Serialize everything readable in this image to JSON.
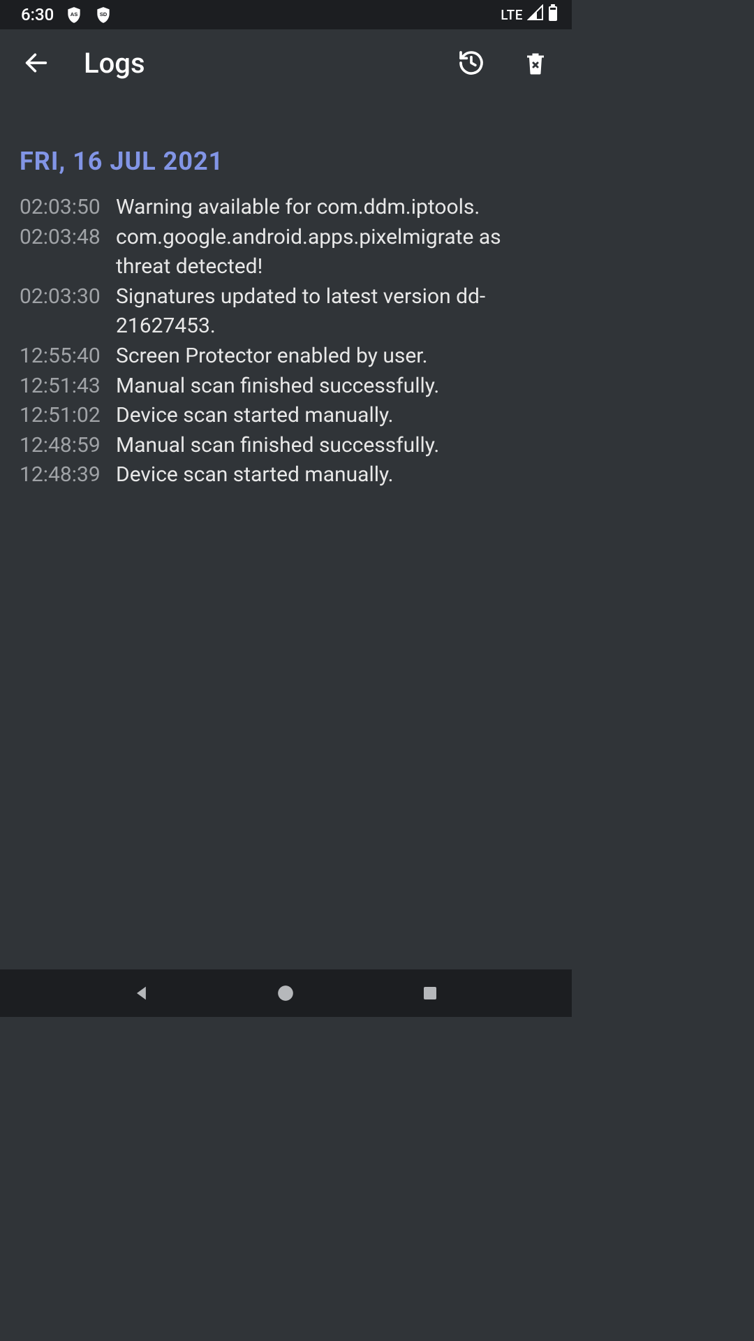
{
  "statusBar": {
    "time": "6:30",
    "badge1": "AS",
    "badge2": "SD",
    "network": "LTE"
  },
  "appBar": {
    "title": "Logs"
  },
  "dateHeader": "FRI, 16 JUL 2021",
  "logs": [
    {
      "time": "02:03:50",
      "message": "Warning available for com.ddm.iptools."
    },
    {
      "time": "02:03:48",
      "message": "com.google.android.apps.pixelmigrate as threat detected!"
    },
    {
      "time": "02:03:30",
      "message": "Signatures updated to latest version dd-21627453."
    },
    {
      "time": "12:55:40",
      "message": "Screen Protector enabled by user."
    },
    {
      "time": "12:51:43",
      "message": "Manual scan finished successfully."
    },
    {
      "time": "12:51:02",
      "message": "Device scan started manually."
    },
    {
      "time": "12:48:59",
      "message": "Manual scan finished successfully."
    },
    {
      "time": "12:48:39",
      "message": "Device scan started manually."
    }
  ]
}
